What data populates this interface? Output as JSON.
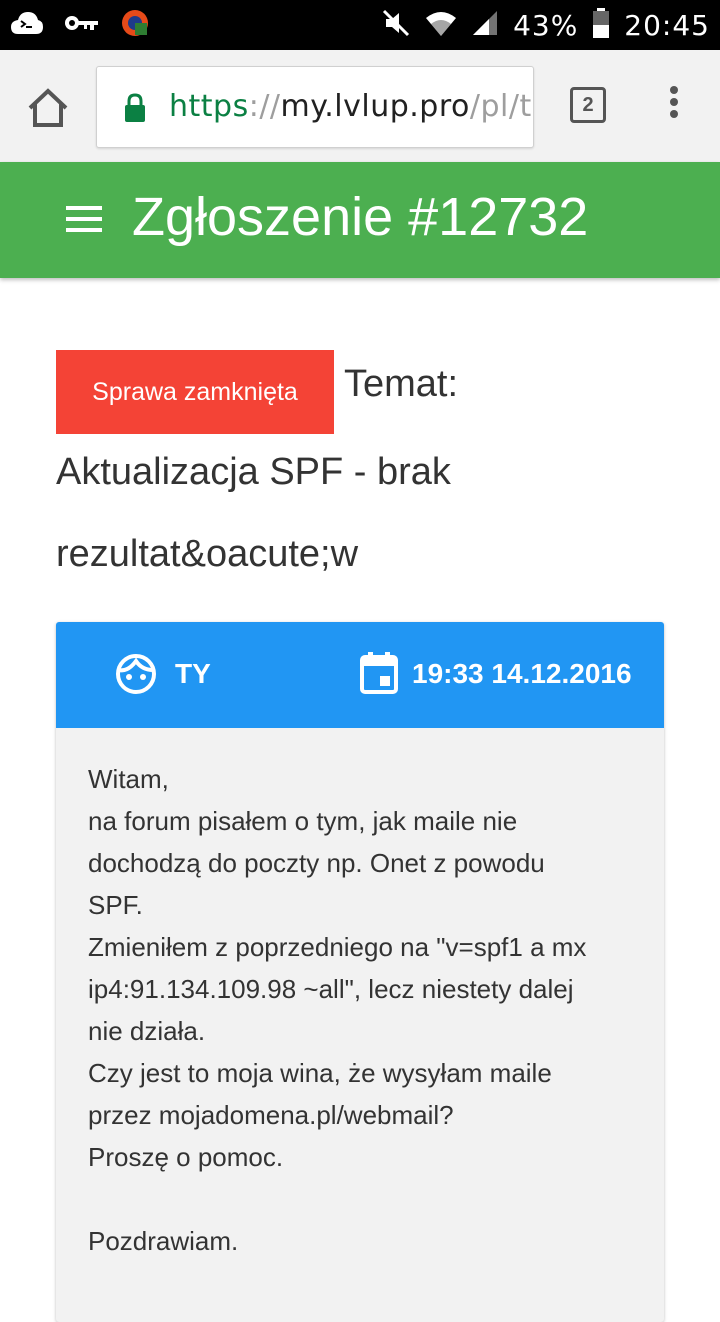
{
  "status_bar": {
    "battery": "43%",
    "time": "20:45"
  },
  "browser": {
    "url_scheme": "https",
    "url_sep": "://",
    "url_host": "my.lvlup.pro",
    "url_path": "/pl/tick",
    "tab_count": "2"
  },
  "app_bar": {
    "title": "Zgłoszenie #12732"
  },
  "ticket": {
    "status": "Sprawa zamknięta",
    "topic_label": "Temat:",
    "topic_line1": "Aktualizacja SPF - brak",
    "topic_line2": "rezultat&oacute;w"
  },
  "message": {
    "author": "TY",
    "datetime": "19:33 14.12.2016",
    "lines": [
      "Witam,",
      "na forum pisałem o tym, jak maile nie",
      "dochodzą do poczty np. Onet z powodu",
      "SPF.",
      "Zmieniłem z poprzedniego na \"v=spf1 a mx",
      "ip4:91.134.109.98 ~all\", lecz niestety dalej",
      "nie działa.",
      "Czy jest to moja wina, że wysyłam maile",
      "przez mojadomena.pl/webmail?",
      "Proszę o pomoc.",
      "",
      "Pozdrawiam."
    ]
  },
  "colors": {
    "app_bar": "#4caf50",
    "status_badge": "#f44336",
    "card_header": "#2196f3",
    "url_secure": "#0b8043"
  },
  "icons": {
    "status_bar_left": [
      "cloud-icon",
      "key-icon",
      "vpn-app-icon"
    ],
    "status_bar_right": [
      "mute-icon",
      "wifi-icon",
      "signal-icon",
      "battery-icon"
    ],
    "browser": [
      "home-icon",
      "lock-icon",
      "tabs-icon",
      "overflow-menu-icon"
    ],
    "app_bar": [
      "hamburger-menu-icon"
    ],
    "card": [
      "face-icon",
      "calendar-icon"
    ]
  }
}
